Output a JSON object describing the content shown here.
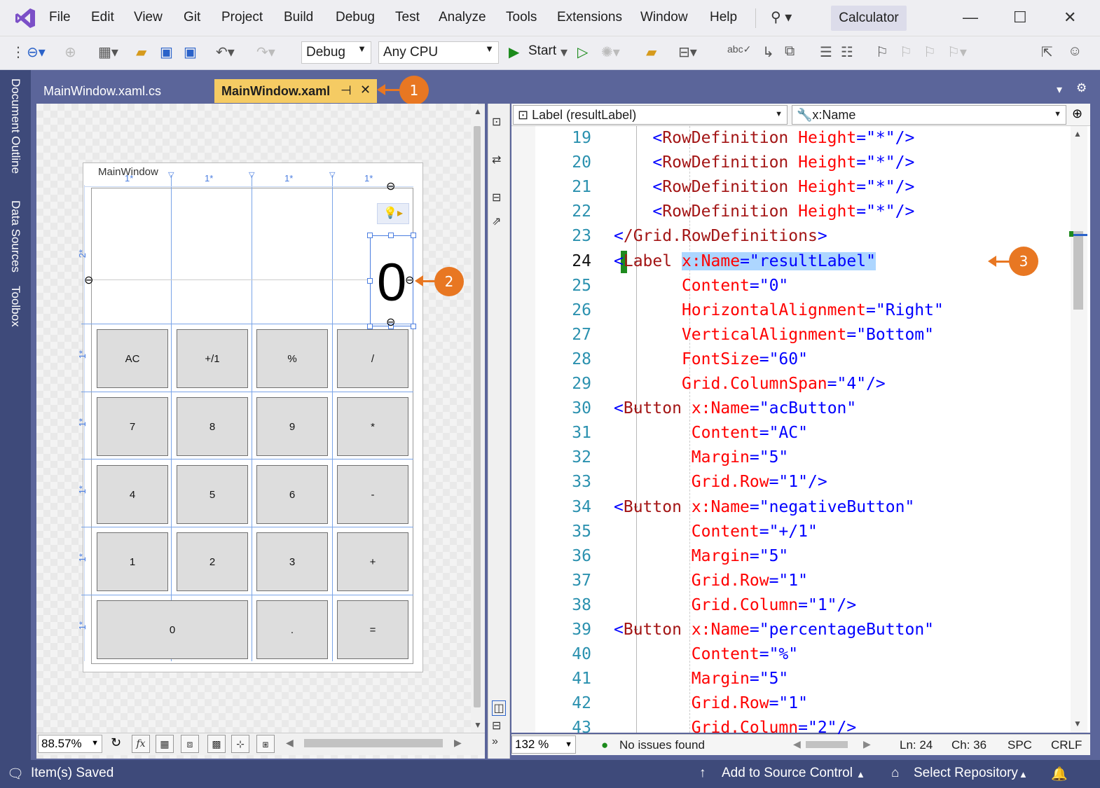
{
  "menu": {
    "items": [
      "File",
      "Edit",
      "View",
      "Git",
      "Project",
      "Build",
      "Debug",
      "Test",
      "Analyze",
      "Tools",
      "Extensions",
      "Window",
      "Help"
    ],
    "solution_name": "Calculator"
  },
  "toolbar": {
    "config": "Debug",
    "platform": "Any CPU",
    "start_label": "Start"
  },
  "dock": {
    "tabs": [
      "Document Outline",
      "Data Sources",
      "Toolbox"
    ]
  },
  "tabs": {
    "inactive": "MainWindow.xaml.cs",
    "active": "MainWindow.xaml"
  },
  "designer": {
    "window_title": "MainWindow",
    "column_marks": [
      "1*",
      "1*",
      "1*",
      "1*"
    ],
    "row_marks": [
      "2*",
      "1*",
      "1*",
      "1*",
      "1*",
      "1*"
    ],
    "result": "0",
    "buttons": [
      [
        "AC",
        "+/1",
        "%",
        "/"
      ],
      [
        "7",
        "8",
        "9",
        "*"
      ],
      [
        "4",
        "5",
        "6",
        "-"
      ],
      [
        "1",
        "2",
        "3",
        "+"
      ],
      [
        "0",
        ".",
        "="
      ]
    ],
    "zoom": "88.57%",
    "fx_label": "fx"
  },
  "editor": {
    "element_combo": "Label (resultLabel)",
    "member_combo": "x:Name",
    "zoom": "132 %",
    "issues": "No issues found",
    "ln": "Ln: 24",
    "ch": "Ch: 36",
    "spc": "SPC",
    "crlf": "CRLF",
    "lines": [
      {
        "n": "19",
        "text": "    <RowDefinition Height=\"*\"/>"
      },
      {
        "n": "20",
        "text": "    <RowDefinition Height=\"*\"/>"
      },
      {
        "n": "21",
        "text": "    <RowDefinition Height=\"*\"/>"
      },
      {
        "n": "22",
        "text": "    <RowDefinition Height=\"*\"/>"
      },
      {
        "n": "23",
        "text": "</Grid.RowDefinitions>"
      },
      {
        "n": "24",
        "text": "<Label x:Name=\"resultLabel\""
      },
      {
        "n": "25",
        "text": "       Content=\"0\""
      },
      {
        "n": "26",
        "text": "       HorizontalAlignment=\"Right\""
      },
      {
        "n": "27",
        "text": "       VerticalAlignment=\"Bottom\""
      },
      {
        "n": "28",
        "text": "       FontSize=\"60\""
      },
      {
        "n": "29",
        "text": "       Grid.ColumnSpan=\"4\"/>"
      },
      {
        "n": "30",
        "text": "<Button x:Name=\"acButton\""
      },
      {
        "n": "31",
        "text": "        Content=\"AC\""
      },
      {
        "n": "32",
        "text": "        Margin=\"5\""
      },
      {
        "n": "33",
        "text": "        Grid.Row=\"1\"/>"
      },
      {
        "n": "34",
        "text": "<Button x:Name=\"negativeButton\""
      },
      {
        "n": "35",
        "text": "        Content=\"+/1\""
      },
      {
        "n": "36",
        "text": "        Margin=\"5\""
      },
      {
        "n": "37",
        "text": "        Grid.Row=\"1\""
      },
      {
        "n": "38",
        "text": "        Grid.Column=\"1\"/>"
      },
      {
        "n": "39",
        "text": "<Button x:Name=\"percentageButton\""
      },
      {
        "n": "40",
        "text": "        Content=\"%\""
      },
      {
        "n": "41",
        "text": "        Margin=\"5\""
      },
      {
        "n": "42",
        "text": "        Grid.Row=\"1\""
      },
      {
        "n": "43",
        "text": "        Grid.Column=\"2\"/>"
      }
    ]
  },
  "callouts": [
    "1",
    "2",
    "3"
  ],
  "status": {
    "left": "Item(s) Saved",
    "source_control": "Add to Source Control",
    "repository": "Select Repository"
  },
  "colors": {
    "accent_frame": "#5b659a",
    "status_bar": "#3e4a7a",
    "active_tab": "#f5cb63",
    "callout": "#e87722",
    "selection": "#add6ff"
  },
  "icons": [
    "visual-studio-logo",
    "search-icon",
    "back-icon",
    "forward-icon",
    "new-project-icon",
    "open-folder-icon",
    "save-icon",
    "save-all-icon",
    "undo-icon",
    "redo-icon",
    "start-icon",
    "pin-icon",
    "close-icon",
    "bulb-icon",
    "bell-icon",
    "git-arrow-icon",
    "repository-icon"
  ]
}
